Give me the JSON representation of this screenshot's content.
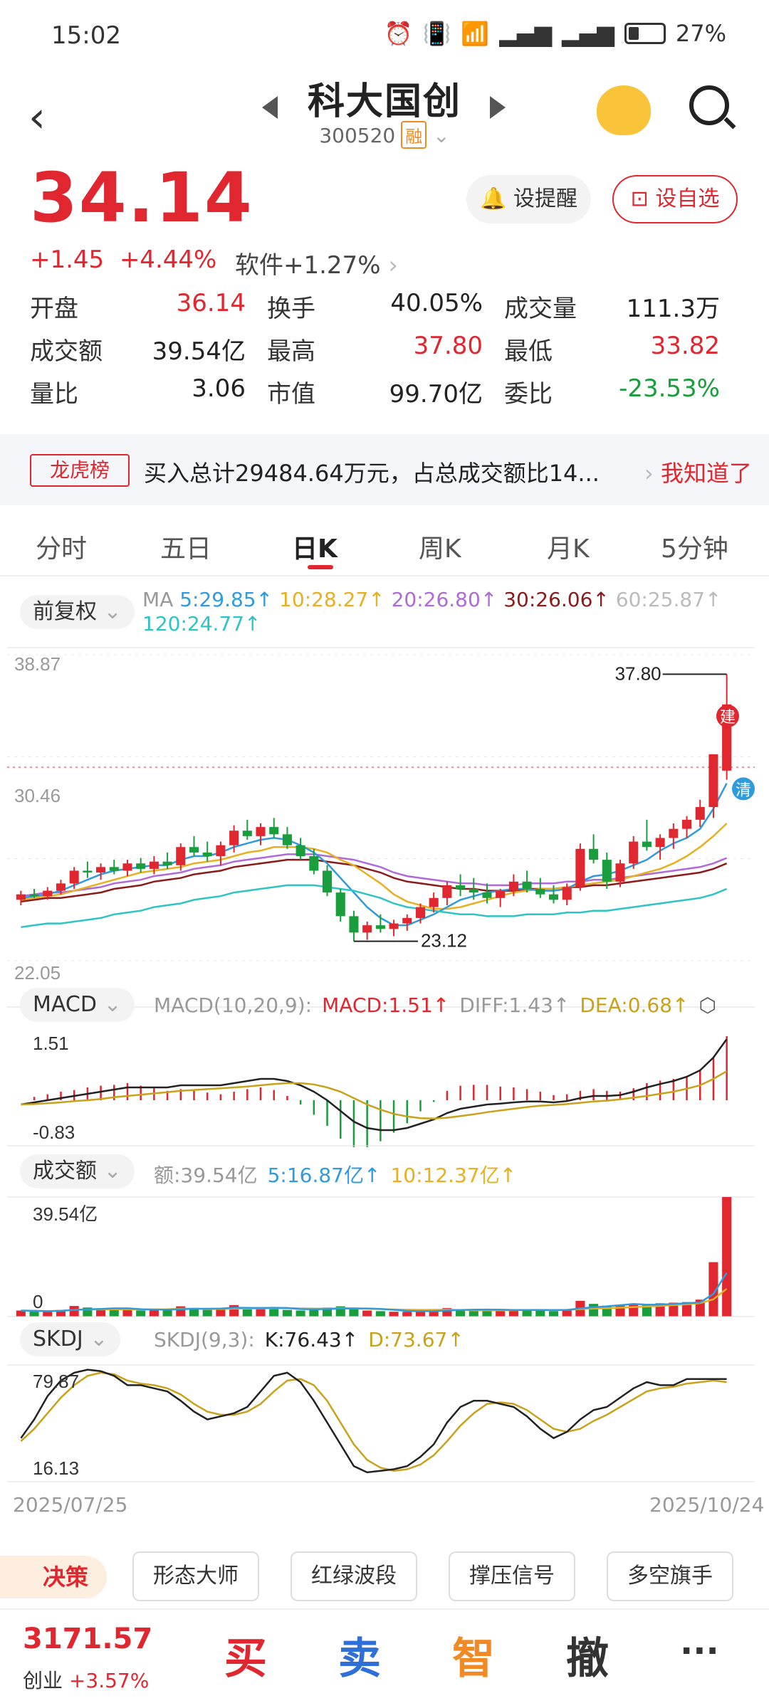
{
  "status": {
    "time": "15:02",
    "battery": "27%"
  },
  "header": {
    "title": "科大国创",
    "code": "300520",
    "badge": "融"
  },
  "quote": {
    "price": "34.14",
    "change": "+1.45",
    "change_pct": "+4.44%",
    "sector": "软件+1.27%",
    "alert_label": "设提醒",
    "fav_label": "设自选",
    "stats": [
      [
        {
          "k": "开盘",
          "v": "36.14",
          "c": "red"
        },
        {
          "k": "换手",
          "v": "40.05%",
          "c": "dark"
        },
        {
          "k": "成交量",
          "v": "111.3万",
          "c": "dark"
        }
      ],
      [
        {
          "k": "成交额",
          "v": "39.54亿",
          "c": "dark"
        },
        {
          "k": "最高",
          "v": "37.80",
          "c": "red"
        },
        {
          "k": "最低",
          "v": "33.82",
          "c": "red"
        }
      ],
      [
        {
          "k": "量比",
          "v": "3.06",
          "c": "dark"
        },
        {
          "k": "市值",
          "v": "99.70亿",
          "c": "dark"
        },
        {
          "k": "委比",
          "v": "-23.53%",
          "c": "green"
        }
      ]
    ]
  },
  "banner": {
    "tag": "龙虎榜",
    "text": "买入总计29484.64万元，占总成交额比14...",
    "ok": "我知道了"
  },
  "tabs": [
    "分时",
    "五日",
    "日K",
    "周K",
    "月K",
    "5分钟"
  ],
  "chart_header": {
    "adjust": "前复权",
    "ma": [
      {
        "label": "MA",
        "c": "#999"
      },
      {
        "label": "5:29.85↑",
        "c": "#2f9bde"
      },
      {
        "label": "10:28.27↑",
        "c": "#e8b020"
      },
      {
        "label": "20:26.80↑",
        "c": "#b06ad8"
      },
      {
        "label": "30:26.06↑",
        "c": "#8b1a1a"
      },
      {
        "label": "60:25.87↑",
        "c": "#bbbbbb"
      }
    ],
    "ma120": "120:24.77↑"
  },
  "kline": {
    "ymax": "38.87",
    "ymid": "30.46",
    "ymin": "22.05",
    "hi_label": "37.80",
    "lo_label": "23.12",
    "badge_buy": "建",
    "badge_clear": "清"
  },
  "macd": {
    "name": "MACD",
    "params": "MACD(10,20,9):",
    "macd": "MACD:1.51↑",
    "diff": "DIFF:1.43↑",
    "dea": "DEA:0.68↑",
    "ytop": "1.51",
    "ybot": "-0.83"
  },
  "vol": {
    "name": "成交额",
    "amt": "额:39.54亿",
    "m5": "5:16.87亿↑",
    "m10": "10:12.37亿↑",
    "ytop": "39.54亿",
    "ybot": "0"
  },
  "skdj": {
    "name": "SKDJ",
    "params": "SKDJ(9,3):",
    "k": "K:76.43↑",
    "d": "D:73.67↑",
    "ytop": "79.87",
    "ybot": "16.13"
  },
  "dates": {
    "start": "2025/07/25",
    "end": "2025/10/24"
  },
  "tools": {
    "juece": "决策",
    "items": [
      "形态大师",
      "红绿波段",
      "撑压信号",
      "多空旗手"
    ]
  },
  "footer": {
    "index": "3171.57",
    "index_name": "创业",
    "index_chg": "+3.57%",
    "buy": "买",
    "sell": "卖",
    "smart": "智",
    "cancel": "撤",
    "more": "···"
  },
  "colors": {
    "up": "#e0262e",
    "down": "#1a9d3c"
  },
  "chart_data": {
    "type": "candlestick",
    "title": "",
    "ylim": [
      22.05,
      38.87
    ],
    "x_range": [
      "2025/07/25",
      "2025/10/24"
    ],
    "annotations": [
      {
        "label": "37.80",
        "kind": "high"
      },
      {
        "label": "23.12",
        "kind": "low"
      }
    ],
    "candles": [
      [
        25.4,
        25.9,
        25.1,
        25.7
      ],
      [
        25.7,
        26.0,
        25.5,
        25.6
      ],
      [
        25.6,
        26.1,
        25.4,
        25.9
      ],
      [
        25.9,
        26.5,
        25.7,
        26.3
      ],
      [
        26.3,
        27.2,
        26.0,
        27.0
      ],
      [
        27.0,
        27.5,
        26.6,
        26.9
      ],
      [
        26.9,
        27.4,
        26.5,
        27.2
      ],
      [
        27.2,
        27.6,
        26.8,
        27.0
      ],
      [
        27.0,
        27.6,
        26.7,
        27.4
      ],
      [
        27.4,
        27.7,
        26.9,
        27.1
      ],
      [
        27.1,
        27.8,
        26.8,
        27.5
      ],
      [
        27.5,
        28.0,
        27.1,
        27.3
      ],
      [
        27.3,
        28.5,
        27.0,
        28.3
      ],
      [
        28.3,
        28.9,
        27.8,
        28.0
      ],
      [
        28.0,
        28.6,
        27.5,
        27.8
      ],
      [
        27.8,
        28.6,
        27.3,
        28.4
      ],
      [
        28.4,
        29.5,
        28.0,
        29.2
      ],
      [
        29.2,
        29.8,
        28.7,
        28.9
      ],
      [
        28.9,
        29.6,
        28.4,
        29.4
      ],
      [
        29.4,
        29.9,
        28.8,
        29.0
      ],
      [
        29.0,
        29.4,
        28.2,
        28.4
      ],
      [
        28.4,
        28.8,
        27.6,
        27.8
      ],
      [
        27.8,
        28.2,
        26.8,
        27.0
      ],
      [
        27.0,
        27.3,
        25.6,
        25.8
      ],
      [
        25.8,
        26.0,
        24.2,
        24.5
      ],
      [
        24.5,
        24.8,
        23.12,
        23.6
      ],
      [
        23.6,
        24.2,
        23.2,
        24.0
      ],
      [
        24.0,
        24.6,
        23.6,
        23.8
      ],
      [
        23.8,
        24.3,
        23.4,
        24.1
      ],
      [
        24.1,
        24.6,
        23.7,
        24.4
      ],
      [
        24.4,
        25.2,
        24.1,
        25.0
      ],
      [
        25.0,
        25.8,
        24.7,
        25.5
      ],
      [
        25.5,
        26.4,
        25.1,
        26.2
      ],
      [
        26.2,
        26.8,
        25.6,
        26.0
      ],
      [
        26.0,
        26.6,
        25.4,
        25.8
      ],
      [
        25.8,
        26.3,
        25.2,
        25.5
      ],
      [
        25.5,
        26.0,
        25.0,
        25.9
      ],
      [
        25.9,
        26.8,
        25.6,
        26.4
      ],
      [
        26.4,
        27.0,
        25.8,
        26.0
      ],
      [
        26.0,
        26.6,
        25.5,
        25.7
      ],
      [
        25.7,
        26.2,
        25.2,
        25.4
      ],
      [
        25.4,
        26.3,
        25.1,
        26.1
      ],
      [
        26.1,
        28.5,
        25.9,
        28.2
      ],
      [
        28.2,
        29.0,
        27.4,
        27.6
      ],
      [
        27.6,
        28.0,
        26.0,
        26.4
      ],
      [
        26.4,
        27.6,
        26.1,
        27.4
      ],
      [
        27.4,
        28.9,
        27.1,
        28.6
      ],
      [
        28.6,
        29.8,
        28.1,
        28.3
      ],
      [
        28.3,
        29.0,
        27.6,
        28.8
      ],
      [
        28.8,
        29.6,
        28.2,
        29.3
      ],
      [
        29.3,
        30.0,
        28.8,
        29.8
      ],
      [
        29.8,
        30.9,
        29.4,
        30.5
      ],
      [
        30.5,
        31.6,
        29.9,
        33.4
      ],
      [
        32.5,
        37.8,
        32.0,
        36.14
      ]
    ],
    "ma5": [
      25.5,
      25.6,
      25.7,
      25.9,
      26.2,
      26.5,
      26.8,
      27.0,
      27.1,
      27.2,
      27.3,
      27.3,
      27.6,
      27.8,
      27.8,
      28.0,
      28.3,
      28.5,
      28.7,
      28.8,
      28.7,
      28.4,
      28.0,
      27.4,
      26.6,
      25.8,
      25.0,
      24.4,
      24.0,
      24.0,
      24.3,
      24.6,
      25.0,
      25.4,
      25.6,
      25.8,
      25.9,
      26.0,
      26.0,
      25.9,
      25.9,
      26.0,
      26.4,
      26.7,
      26.8,
      27.0,
      27.3,
      27.6,
      28.1,
      28.5,
      28.8,
      29.3,
      30.4,
      31.8
    ],
    "ma10": [
      25.4,
      25.5,
      25.6,
      25.7,
      25.9,
      26.1,
      26.3,
      26.5,
      26.7,
      26.9,
      27.0,
      27.1,
      27.2,
      27.4,
      27.5,
      27.6,
      27.8,
      28.0,
      28.1,
      28.3,
      28.3,
      28.3,
      28.2,
      28.0,
      27.6,
      27.3,
      26.8,
      26.3,
      25.7,
      25.3,
      25.1,
      24.9,
      24.9,
      25.0,
      25.2,
      25.4,
      25.6,
      25.8,
      25.9,
      26.0,
      26.0,
      26.1,
      26.2,
      26.3,
      26.4,
      26.5,
      26.7,
      26.9,
      27.1,
      27.4,
      27.8,
      28.3,
      28.9,
      29.6
    ],
    "ma20": [
      25.3,
      25.4,
      25.5,
      25.5,
      25.6,
      25.7,
      25.8,
      26.0,
      26.1,
      26.2,
      26.4,
      26.5,
      26.6,
      26.8,
      26.9,
      27.0,
      27.2,
      27.3,
      27.4,
      27.5,
      27.6,
      27.6,
      27.6,
      27.5,
      27.4,
      27.3,
      27.1,
      26.9,
      26.6,
      26.4,
      26.3,
      26.2,
      26.1,
      26.0,
      26.0,
      25.9,
      25.9,
      25.9,
      26.0,
      26.0,
      26.0,
      26.1,
      26.1,
      26.2,
      26.2,
      26.3,
      26.4,
      26.5,
      26.6,
      26.7,
      26.8,
      26.9,
      27.1,
      27.4
    ],
    "macd_diff": [
      -0.1,
      -0.05,
      0.0,
      0.05,
      0.1,
      0.15,
      0.2,
      0.25,
      0.3,
      0.3,
      0.3,
      0.3,
      0.35,
      0.35,
      0.35,
      0.35,
      0.4,
      0.45,
      0.5,
      0.5,
      0.45,
      0.35,
      0.2,
      0.0,
      -0.25,
      -0.5,
      -0.65,
      -0.7,
      -0.7,
      -0.65,
      -0.55,
      -0.45,
      -0.3,
      -0.2,
      -0.15,
      -0.1,
      -0.08,
      -0.05,
      -0.03,
      -0.03,
      -0.05,
      -0.02,
      0.05,
      0.1,
      0.1,
      0.12,
      0.2,
      0.3,
      0.38,
      0.45,
      0.55,
      0.7,
      1.0,
      1.43
    ],
    "macd_dea": [
      -0.1,
      -0.09,
      -0.07,
      -0.05,
      -0.02,
      0.0,
      0.03,
      0.07,
      0.1,
      0.13,
      0.16,
      0.19,
      0.22,
      0.24,
      0.26,
      0.28,
      0.3,
      0.32,
      0.35,
      0.38,
      0.4,
      0.4,
      0.37,
      0.3,
      0.2,
      0.05,
      -0.1,
      -0.22,
      -0.32,
      -0.38,
      -0.42,
      -0.43,
      -0.41,
      -0.37,
      -0.33,
      -0.28,
      -0.24,
      -0.2,
      -0.16,
      -0.13,
      -0.11,
      -0.09,
      -0.06,
      -0.03,
      -0.01,
      0.02,
      0.06,
      0.1,
      0.15,
      0.2,
      0.27,
      0.35,
      0.5,
      0.68
    ],
    "volume": [
      2.0,
      1.8,
      1.6,
      2.2,
      3.5,
      3.0,
      2.4,
      2.6,
      2.2,
      2.0,
      2.4,
      2.2,
      3.4,
      2.8,
      2.2,
      2.6,
      3.8,
      3.0,
      2.6,
      2.6,
      2.2,
      2.0,
      2.6,
      3.0,
      3.4,
      2.4,
      2.0,
      1.8,
      1.6,
      1.6,
      1.8,
      2.2,
      2.8,
      2.4,
      2.2,
      2.0,
      2.0,
      2.4,
      2.4,
      2.0,
      1.8,
      2.2,
      5.2,
      4.2,
      3.6,
      3.6,
      4.2,
      4.0,
      4.4,
      4.6,
      4.8,
      5.6,
      18.0,
      39.54
    ],
    "skdj_k": [
      38,
      50,
      65,
      75,
      80,
      82,
      81,
      78,
      72,
      72,
      70,
      68,
      62,
      55,
      50,
      52,
      54,
      58,
      68,
      78,
      80,
      74,
      62,
      48,
      34,
      20,
      16,
      17,
      18,
      20,
      26,
      34,
      48,
      58,
      62,
      62,
      60,
      58,
      52,
      44,
      38,
      42,
      50,
      56,
      58,
      64,
      70,
      74,
      72,
      72,
      76,
      76,
      76,
      76
    ],
    "skdj_d": [
      36,
      44,
      54,
      64,
      72,
      78,
      80,
      79,
      75,
      73,
      72,
      70,
      66,
      60,
      55,
      53,
      53,
      55,
      60,
      68,
      75,
      76,
      72,
      62,
      48,
      34,
      24,
      19,
      17,
      18,
      21,
      27,
      36,
      46,
      54,
      60,
      61,
      60,
      56,
      50,
      44,
      42,
      44,
      49,
      53,
      58,
      63,
      68,
      70,
      71,
      73,
      74,
      75,
      74
    ]
  }
}
